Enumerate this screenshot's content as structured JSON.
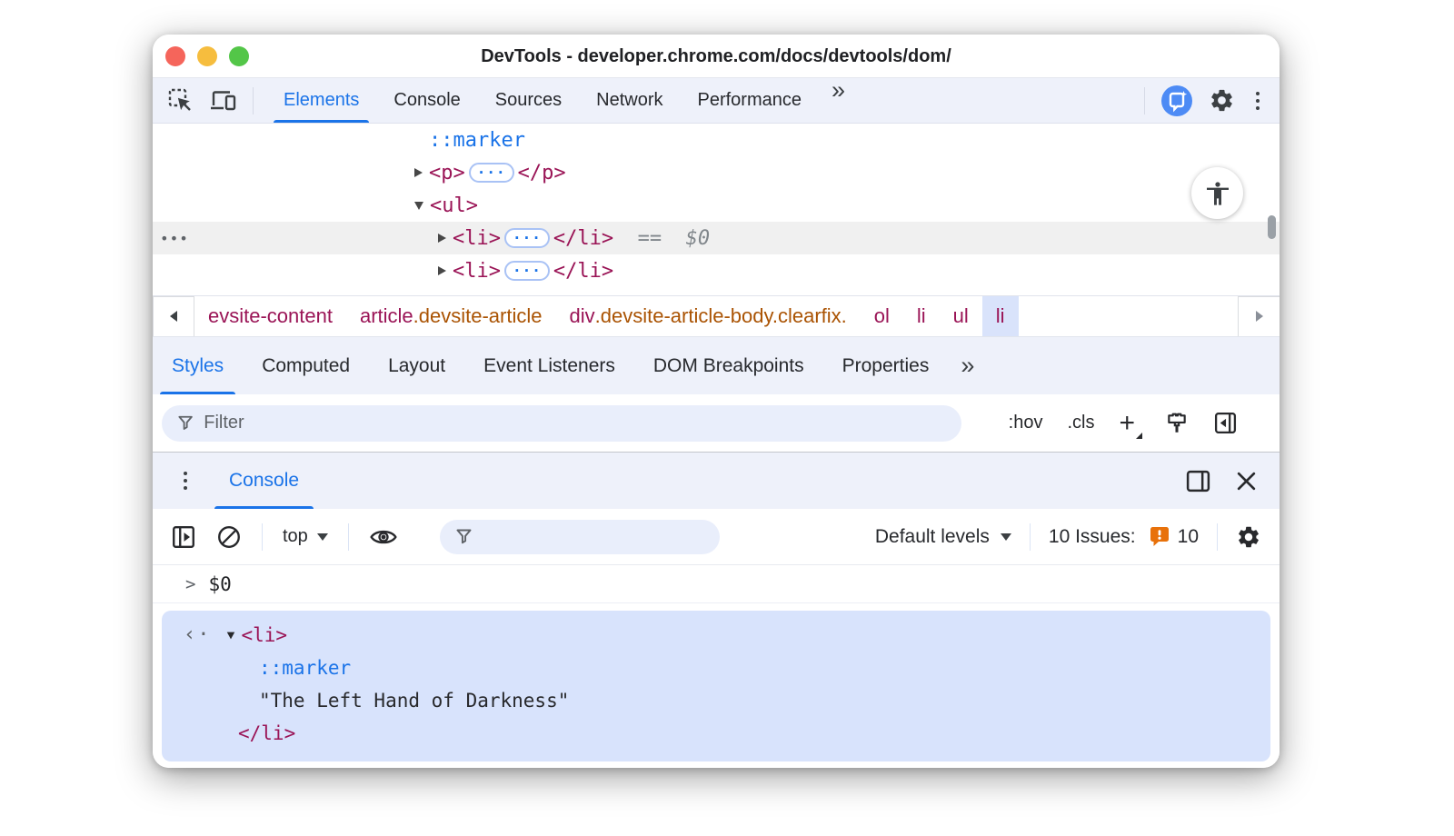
{
  "colors": {
    "accent": "#1a73e8",
    "tag": "#9a1456",
    "class_attr": "#aa5303",
    "issues_badge": "#e8710a",
    "toolbar_bg": "#eef1fa",
    "selection_bg": "#d8e3fc"
  },
  "titlebar": {
    "title": "DevTools - developer.chrome.com/docs/devtools/dom/"
  },
  "tabbar": {
    "tabs": [
      "Elements",
      "Console",
      "Sources",
      "Network",
      "Performance"
    ],
    "more": "»"
  },
  "domtree": {
    "overflow_dots": "•••",
    "marker": "::marker",
    "p_open": "<p>",
    "p_close": "</p>",
    "ul_open": "<ul>",
    "li_open": "<li>",
    "li_close": "</li>",
    "li2_open": "<li>",
    "li2_close": "</li>",
    "eq": "==",
    "dollar": "$0",
    "ellipsis": "···"
  },
  "breadcrumb": {
    "items": [
      {
        "tag": "evsite-content",
        "cls": ""
      },
      {
        "tag": "article",
        "cls": ".devsite-article"
      },
      {
        "tag": "div",
        "cls": ".devsite-article-body.clearfix."
      },
      {
        "tag": "ol",
        "cls": ""
      },
      {
        "tag": "li",
        "cls": ""
      },
      {
        "tag": "ul",
        "cls": ""
      },
      {
        "tag": "li",
        "cls": ""
      }
    ]
  },
  "styles_panel": {
    "tabs": [
      "Styles",
      "Computed",
      "Layout",
      "Event Listeners",
      "DOM Breakpoints",
      "Properties"
    ],
    "more": "»",
    "filter_placeholder": "Filter",
    "hov": ":hov",
    "cls": ".cls",
    "plus": "+"
  },
  "drawer": {
    "tab": "Console"
  },
  "console_toolbar": {
    "context": "top",
    "levels": "Default levels",
    "issues_label": "10 Issues:",
    "issues_count": "10"
  },
  "console": {
    "prompt": ">",
    "command": "$0",
    "result": {
      "indicator": "‹·",
      "li_open": "<li>",
      "marker": "::marker",
      "text": "\"The Left Hand of Darkness\"",
      "li_close": "</li>"
    }
  }
}
